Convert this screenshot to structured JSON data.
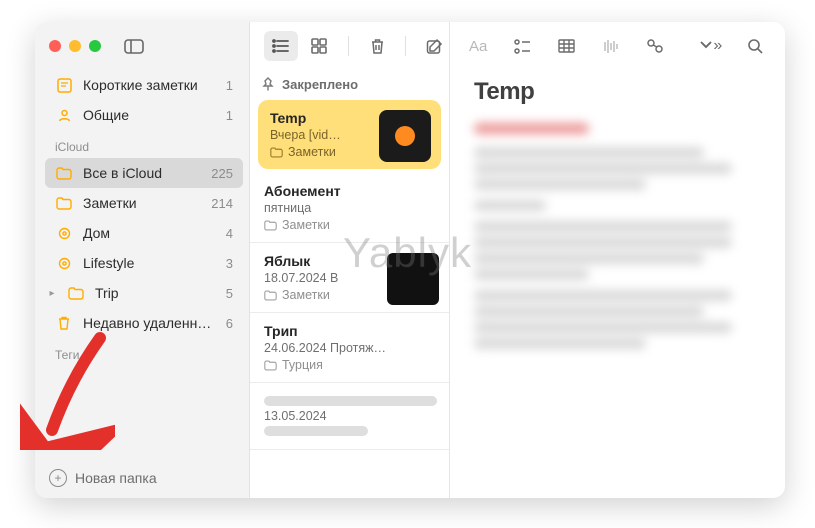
{
  "sidebar": {
    "quick": [
      {
        "icon": "quick",
        "label": "Короткие заметки",
        "count": "1"
      },
      {
        "icon": "shared",
        "label": "Общие",
        "count": "1"
      }
    ],
    "section": "iCloud",
    "folders": [
      {
        "icon": "folder",
        "label": "Все в iCloud",
        "count": "225",
        "selected": true
      },
      {
        "icon": "folder",
        "label": "Заметки",
        "count": "214"
      },
      {
        "icon": "gear",
        "label": "Дом",
        "count": "4"
      },
      {
        "icon": "gear",
        "label": "Lifestyle",
        "count": "3"
      },
      {
        "icon": "folder-exp",
        "label": "Trip",
        "count": "5"
      },
      {
        "icon": "trash",
        "label": "Недавно удаленн…",
        "count": "6"
      }
    ],
    "tags_label": "Теги",
    "footer": "Новая папка"
  },
  "mid": {
    "pinned_label": "Закреплено",
    "notes": [
      {
        "title": "Temp",
        "sub": "Вчера  [vid…",
        "folder": "Заметки",
        "selected": true,
        "thumb": "orange"
      },
      {
        "title": "Абонемент",
        "sub": "пятница",
        "folder": "Заметки"
      },
      {
        "title": "Яблык",
        "sub": "18.07.2024  В",
        "folder": "Заметки",
        "thumb": "dark"
      },
      {
        "title": "Трип",
        "sub": "24.06.2024  Протяж…",
        "folder": "Турция"
      },
      {
        "title": "",
        "sub": "13.05.2024",
        "folder": "",
        "blurred": true
      }
    ]
  },
  "content": {
    "title": "Temp"
  },
  "watermark": "Yablyk"
}
